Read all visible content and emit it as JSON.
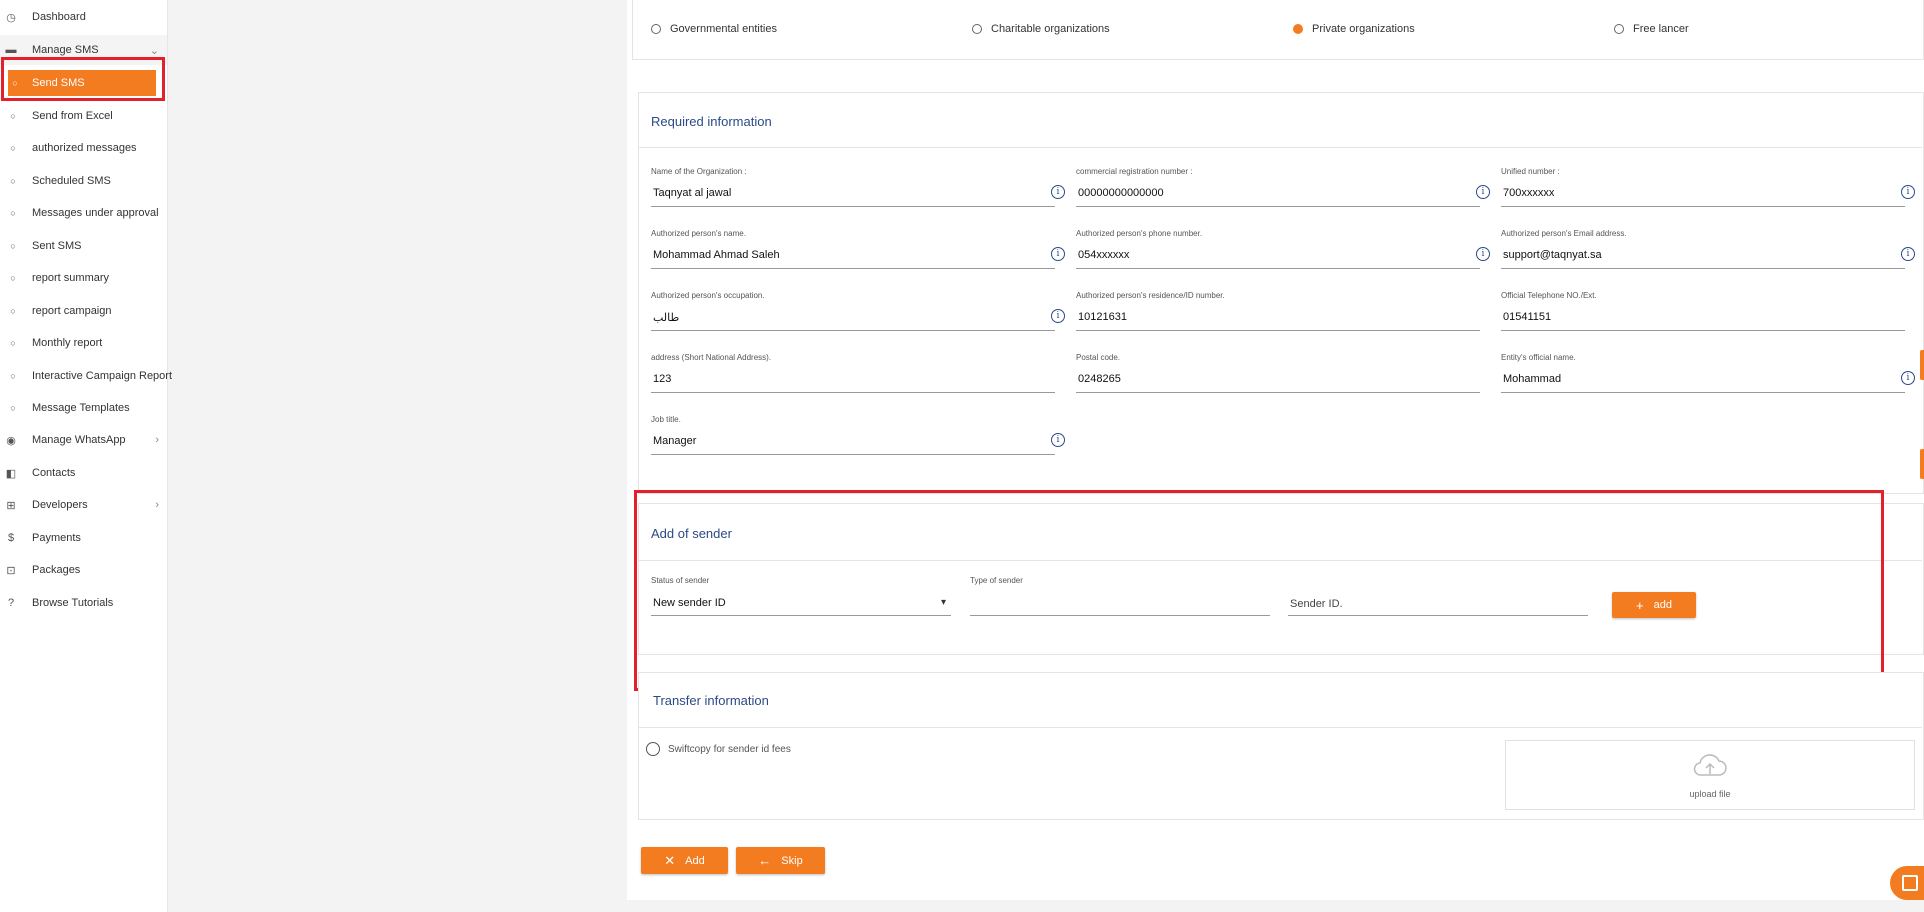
{
  "sidebar": {
    "items": [
      {
        "label": "Dashboard",
        "icon": "dashboard-icon",
        "glyph": "◷"
      },
      {
        "label": "Manage SMS",
        "icon": "message-icon",
        "glyph": "▬",
        "chevron": "⌄"
      },
      {
        "label": "Send SMS",
        "icon": "bullet-icon",
        "glyph": "○"
      },
      {
        "label": "Send from Excel",
        "icon": "bullet-icon",
        "glyph": "○"
      },
      {
        "label": "authorized messages",
        "icon": "bullet-icon",
        "glyph": "○"
      },
      {
        "label": "Scheduled SMS",
        "icon": "bullet-icon",
        "glyph": "○"
      },
      {
        "label": "Messages under approval",
        "icon": "bullet-icon",
        "glyph": "○"
      },
      {
        "label": "Sent SMS",
        "icon": "bullet-icon",
        "glyph": "○"
      },
      {
        "label": "report summary",
        "icon": "bullet-icon",
        "glyph": "○"
      },
      {
        "label": "report campaign",
        "icon": "bullet-icon",
        "glyph": "○"
      },
      {
        "label": "Monthly report",
        "icon": "bullet-icon",
        "glyph": "○"
      },
      {
        "label": "Interactive Campaign Report",
        "icon": "bullet-icon",
        "glyph": "○"
      },
      {
        "label": "Message Templates",
        "icon": "bullet-icon",
        "glyph": "○"
      },
      {
        "label": "Manage WhatsApp",
        "icon": "whatsapp-icon",
        "glyph": "◉",
        "chevron": "›"
      },
      {
        "label": "Contacts",
        "icon": "contacts-icon",
        "glyph": "◧"
      },
      {
        "label": "Developers",
        "icon": "developers-icon",
        "glyph": "⊞",
        "chevron": "›"
      },
      {
        "label": "Payments",
        "icon": "dollar-icon",
        "glyph": "$"
      },
      {
        "label": "Packages",
        "icon": "package-icon",
        "glyph": "⊡"
      },
      {
        "label": "Browse Tutorials",
        "icon": "help-icon",
        "glyph": "?"
      }
    ]
  },
  "entity_types": {
    "options": [
      "Governmental entities",
      "Charitable organizations",
      "Private organizations",
      "Free lancer"
    ],
    "selected": "Private organizations"
  },
  "required_info": {
    "title": "Required information",
    "fields": [
      {
        "label": "Name of the Organization :",
        "value": "Taqnyat al jawal",
        "info": true
      },
      {
        "label": "commercial registration number :",
        "value": "00000000000000",
        "info": true
      },
      {
        "label": "Unified number :",
        "value": "700xxxxxx",
        "info": true
      },
      {
        "label": "Authorized person's name.",
        "value": "Mohammad Ahmad Saleh",
        "info": true
      },
      {
        "label": "Authorized person's phone number.",
        "value": "054xxxxxx",
        "info": true
      },
      {
        "label": "Authorized person's Email address.",
        "value": "support@taqnyat.sa",
        "info": true
      },
      {
        "label": "Authorized person's occupation.",
        "value": "طالب",
        "info": true
      },
      {
        "label": "Authorized person's residence/ID number.",
        "value": "10121631",
        "info": false
      },
      {
        "label": "Official Telephone NO./Ext.",
        "value": "01541151",
        "info": false
      },
      {
        "label": "address (Short National Address).",
        "value": "123",
        "info": false
      },
      {
        "label": "Postal code.",
        "value": "0248265",
        "info": false
      },
      {
        "label": "Entity's official name.",
        "value": "Mohammad",
        "info": true
      },
      {
        "label": "Job title.",
        "value": "Manager",
        "info": true
      }
    ]
  },
  "add_sender": {
    "title": "Add of sender",
    "status_label": "Status of sender",
    "status_value": "New sender ID",
    "status_caret": "▾",
    "type_label": "Type of sender",
    "type_value": "",
    "sender_id_placeholder": "Sender ID.",
    "add_button": "add",
    "add_icon": "+"
  },
  "transfer": {
    "title": "Transfer information",
    "swiftcopy_label": "Swiftcopy for sender id fees",
    "upload_label": "upload file"
  },
  "footer": {
    "add_button": "Add",
    "skip_button": "Skip"
  },
  "colors": {
    "accent": "#f47c20",
    "title": "#2b4a86",
    "annotation": "#e3202b"
  }
}
